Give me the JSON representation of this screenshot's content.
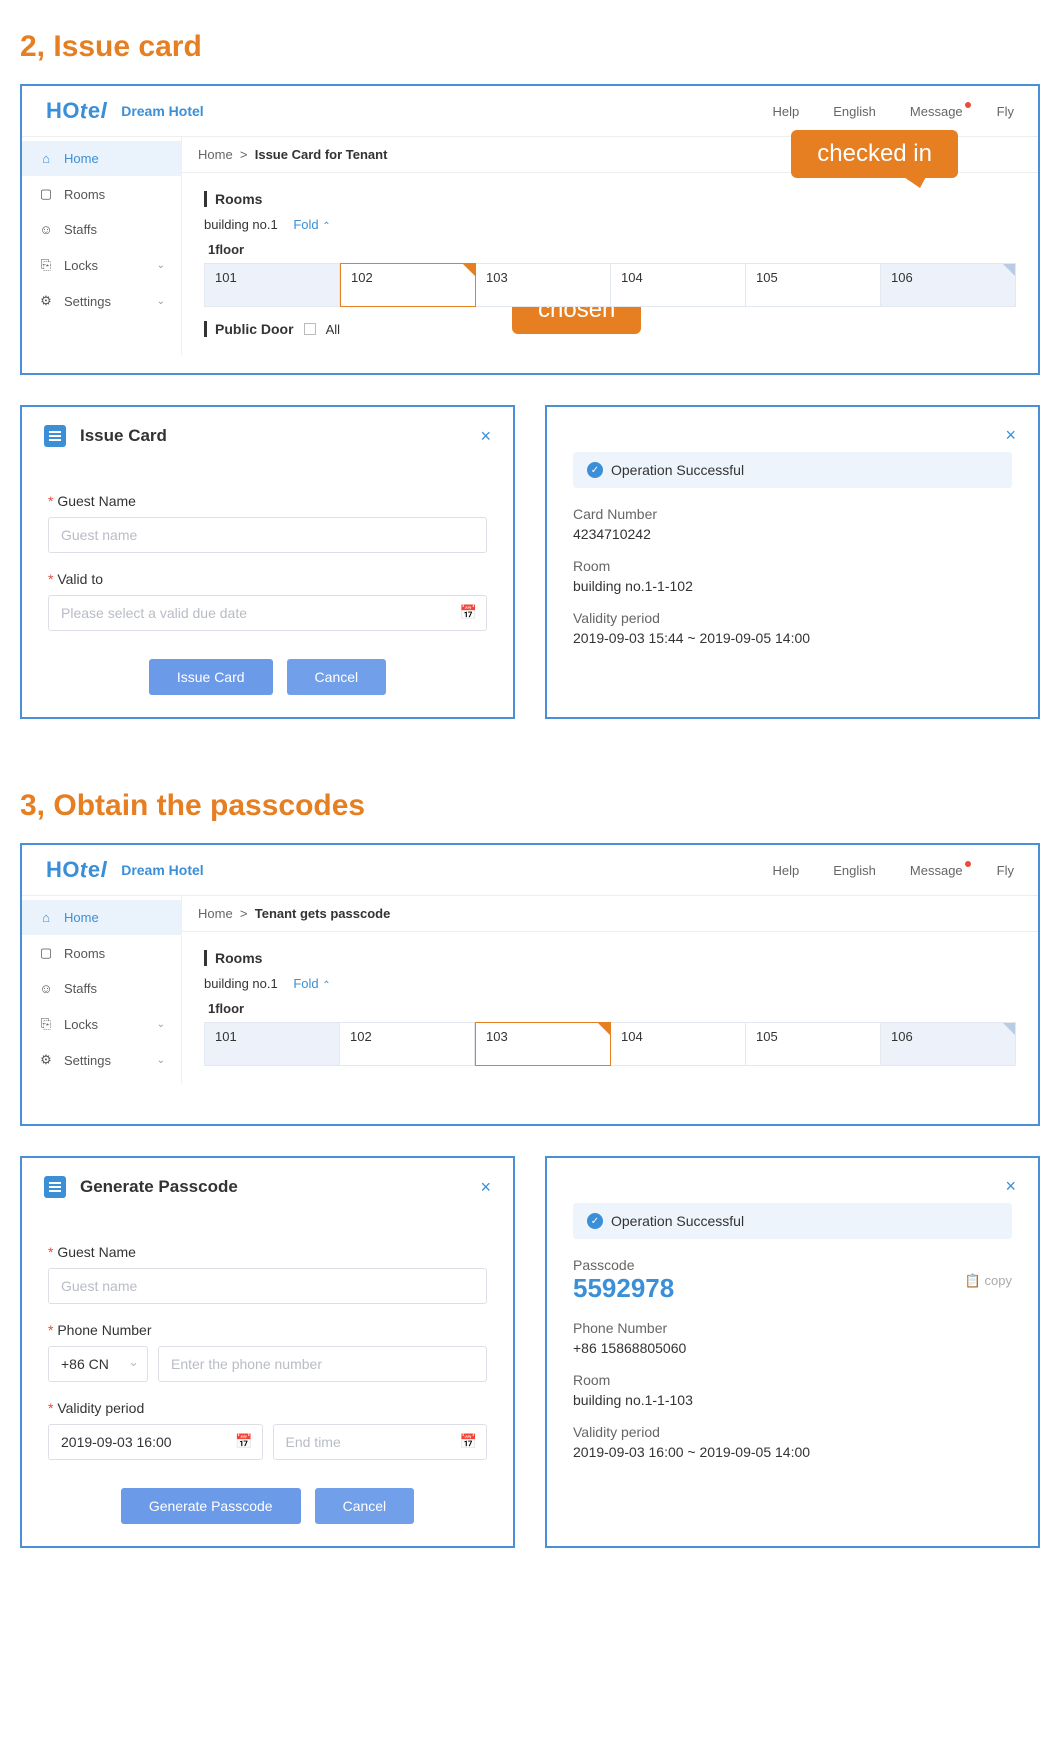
{
  "section2": {
    "title": "2, Issue card"
  },
  "section3": {
    "title": "3, Obtain the passcodes"
  },
  "hotel": {
    "name": "Dream Hotel"
  },
  "topnav": {
    "help": "Help",
    "lang": "English",
    "message": "Message",
    "user": "Fly"
  },
  "sidebar": {
    "items": [
      {
        "label": "Home"
      },
      {
        "label": "Rooms"
      },
      {
        "label": "Staffs"
      },
      {
        "label": "Locks"
      },
      {
        "label": "Settings"
      }
    ]
  },
  "breadcrumb1": {
    "root": "Home",
    "page": "Issue Card for Tenant"
  },
  "breadcrumb2": {
    "root": "Home",
    "page": "Tenant gets passcode"
  },
  "rooms": {
    "section": "Rooms",
    "building": "building no.1",
    "fold": "Fold",
    "floor": "1floor",
    "cells1": [
      "101",
      "102",
      "103",
      "104",
      "105",
      "106"
    ],
    "cells2": [
      "101",
      "102",
      "103",
      "104",
      "105",
      "106"
    ],
    "publicDoor": "Public Door",
    "all": "All"
  },
  "callouts": {
    "checked": "checked in",
    "chosen": "chosen"
  },
  "issueCard": {
    "title": "Issue Card",
    "guestLabel": "Guest Name",
    "guestPH": "Guest name",
    "validLabel": "Valid to",
    "validPH": "Please select a valid due date",
    "submit": "Issue Card",
    "cancel": "Cancel"
  },
  "cardResult": {
    "success": "Operation Successful",
    "cardNumberLabel": "Card Number",
    "cardNumber": "4234710242",
    "roomLabel": "Room",
    "room": "building no.1-1-102",
    "validityLabel": "Validity period",
    "validity": "2019-09-03 15:44  ~  2019-09-05 14:00"
  },
  "genPass": {
    "title": "Generate Passcode",
    "guestLabel": "Guest Name",
    "guestPH": "Guest name",
    "phoneLabel": "Phone Number",
    "country": "+86 CN",
    "phonePH": "Enter the phone number",
    "validityLabel": "Validity period",
    "start": "2019-09-03 16:00",
    "endPH": "End time",
    "submit": "Generate Passcode",
    "cancel": "Cancel"
  },
  "passResult": {
    "success": "Operation Successful",
    "passLabel": "Passcode",
    "passcode": "5592978",
    "copy": "copy",
    "phoneLabel": "Phone Number",
    "phone": "+86 15868805060",
    "roomLabel": "Room",
    "room": "building no.1-1-103",
    "validityLabel": "Validity period",
    "validity": "2019-09-03 16:00  ~  2019-09-05 14:00"
  }
}
